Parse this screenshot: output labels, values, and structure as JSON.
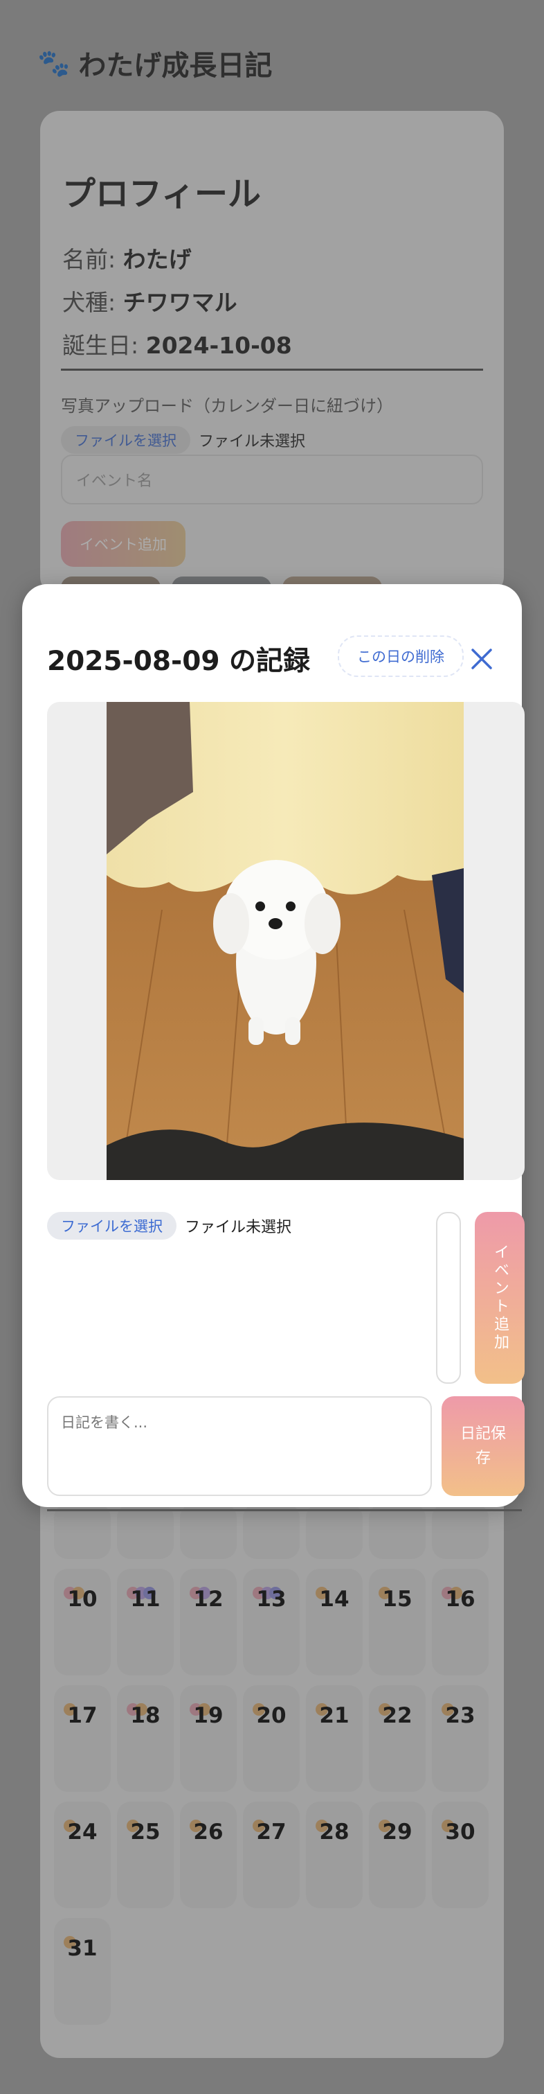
{
  "app": {
    "title": "わたげ成長日記"
  },
  "profile": {
    "heading": "プロフィール",
    "name_label": "名前:",
    "name_value": "わたげ",
    "breed_label": "犬種:",
    "breed_value": "チワワマル",
    "birthday_label": "誕生日:",
    "birthday_value": "2024-10-08",
    "upload_label": "写真アップロード（カレンダー日に紐づけ）",
    "file_button": "ファイルを選択",
    "file_status": "ファイル未選択",
    "event_placeholder": "イベント名",
    "event_button": "イベント追加"
  },
  "modal": {
    "title": "2025-08-09 の記録",
    "delete_button": "この日の削除",
    "file_button": "ファイルを選択",
    "file_status": "ファイル未選択",
    "event_button": "イベント追加",
    "diary_placeholder": "日記を書く...",
    "save_button": "日記保存"
  },
  "calendar": {
    "weeks": [
      [
        {
          "day": ""
        },
        {
          "day": ""
        },
        {
          "day": ""
        },
        {
          "day": ""
        },
        {
          "day": ""
        },
        {
          "day": ""
        },
        {
          "day": ""
        }
      ],
      [
        {
          "day": "10",
          "dots": [
            "#e5a0b0",
            "#e3b06c"
          ]
        },
        {
          "day": "11",
          "dots": [
            "#e5a0b0",
            "#b49ce0",
            "#8f8fe0"
          ]
        },
        {
          "day": "12",
          "dots": [
            "#e5a0b0",
            "#b49ce0"
          ]
        },
        {
          "day": "13",
          "dots": [
            "#e5a0b0",
            "#b49ce0",
            "#8f8fe0"
          ]
        },
        {
          "day": "14",
          "dots": [
            "#e3b06c"
          ]
        },
        {
          "day": "15",
          "dots": [
            "#e3b06c"
          ]
        },
        {
          "day": "16",
          "dots": [
            "#e5a0b0",
            "#e3b06c"
          ]
        }
      ],
      [
        {
          "day": "17",
          "dots": [
            "#e3b06c"
          ]
        },
        {
          "day": "18",
          "dots": [
            "#e5a0b0",
            "#e3b06c"
          ]
        },
        {
          "day": "19",
          "dots": [
            "#e5a0b0",
            "#e3b06c"
          ]
        },
        {
          "day": "20",
          "dots": [
            "#e3b06c"
          ]
        },
        {
          "day": "21",
          "dots": [
            "#e3b06c"
          ]
        },
        {
          "day": "22",
          "dots": [
            "#e3b06c"
          ]
        },
        {
          "day": "23",
          "dots": [
            "#e3b06c"
          ]
        }
      ],
      [
        {
          "day": "24",
          "dots": [
            "#e3b06c"
          ]
        },
        {
          "day": "25",
          "dots": [
            "#e3b06c"
          ]
        },
        {
          "day": "26",
          "dots": [
            "#e3b06c"
          ]
        },
        {
          "day": "27",
          "dots": [
            "#e3b06c"
          ]
        },
        {
          "day": "28",
          "dots": [
            "#e3b06c"
          ]
        },
        {
          "day": "29",
          "dots": [
            "#e3b06c"
          ]
        },
        {
          "day": "30",
          "dots": [
            "#e3b06c"
          ]
        }
      ],
      [
        {
          "day": "31",
          "dots": [
            "#e3b06c"
          ]
        }
      ]
    ]
  },
  "colors": {
    "accent_blue": "#3f6bd1",
    "gradient_pink": "#ee9aa9",
    "gradient_peach": "#f2c089"
  },
  "icons": {
    "paw": "paw-icon",
    "close": "close-icon"
  }
}
